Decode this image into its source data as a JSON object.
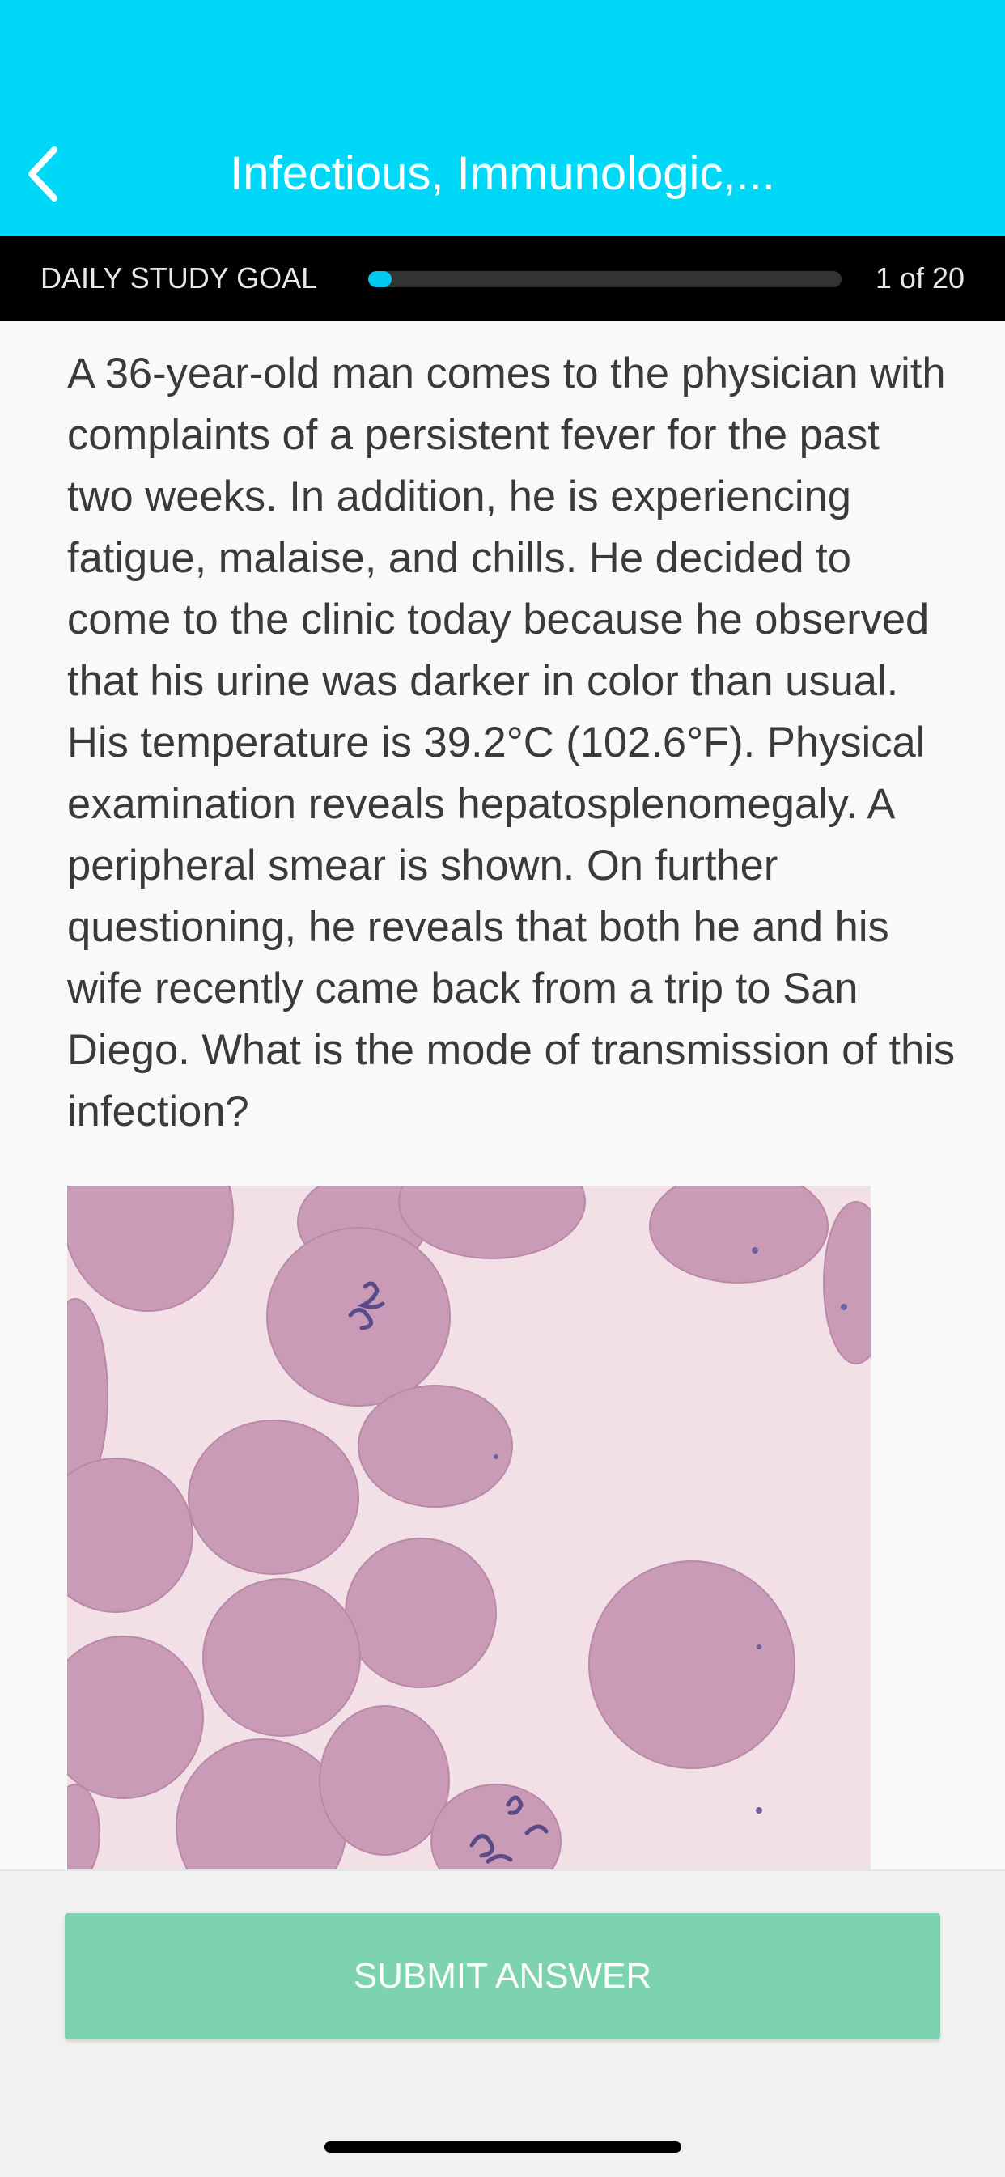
{
  "header": {
    "title": "Infectious, Immunologic,...",
    "back_icon": "chevron-left-icon",
    "background": "#00d8f8"
  },
  "study_goal": {
    "label": "DAILY STUDY GOAL",
    "count_text": "1 of 20",
    "progress_fraction": 0.05,
    "fill_color": "#00c8ef"
  },
  "question": {
    "text": "A 36-year-old man comes to the physician with complaints of a persistent fever for the past two weeks. In addition, he is experiencing fatigue, malaise, and chills. He decided to come to the clinic today because he observed that his urine was darker in color than usual. His temperature is 39.2°C (102.6°F). Physical examination reveals hepatosplenomegaly. A peripheral smear is shown. On further questioning, he reveals that both he and his wife recently came back from a trip to San Diego. What is the mode of transmission of this infection?"
  },
  "image": {
    "subject": "peripheral blood smear"
  },
  "footer": {
    "submit_label": "SUBMIT ANSWER",
    "button_color": "#7dd3b0"
  }
}
